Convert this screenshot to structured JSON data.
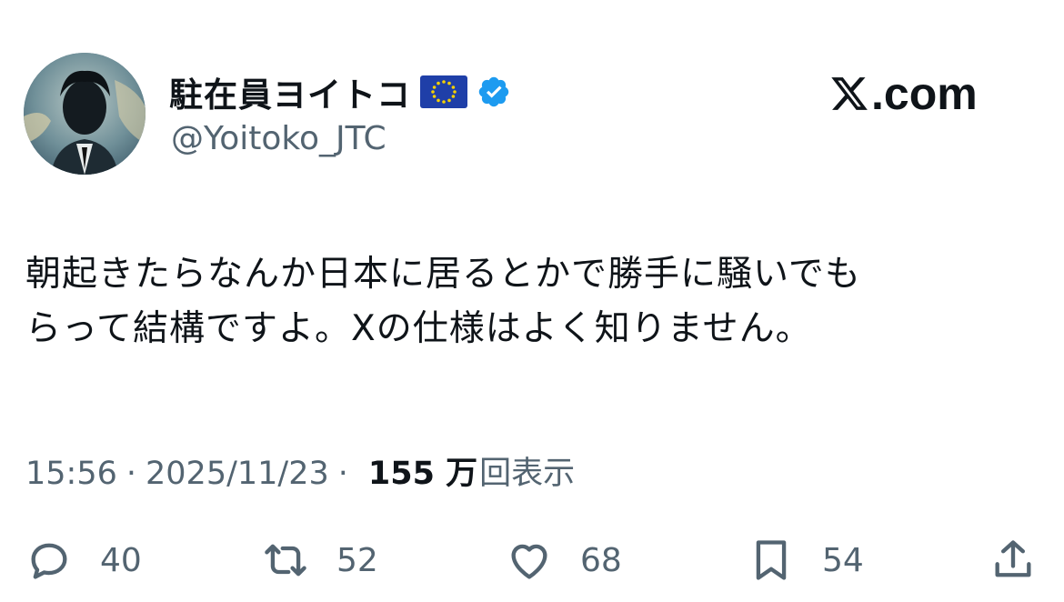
{
  "user": {
    "display_name": "駐在員ヨイトコ",
    "handle": "@Yoitoko_JTC",
    "flag_icon": "eu-flag-icon",
    "verified_icon": "verified-badge-icon",
    "verified_color": "#1d9bf0"
  },
  "brand": {
    "text": ".com",
    "logo_icon": "x-logo-icon"
  },
  "tweet": {
    "text": "朝起きたらなんか日本に居るとかで勝手に騒いでも\nらって結構ですよ。Xの仕様はよく知りません。"
  },
  "meta": {
    "time": "15:56",
    "separator": "·",
    "date": "2025/11/23",
    "views_count": "155 万",
    "views_label": "回表示"
  },
  "actions": {
    "replies": "40",
    "reposts": "52",
    "likes": "68",
    "bookmarks": "54"
  },
  "colors": {
    "text": "#0f1419",
    "secondary": "#536471",
    "accent": "#1d9bf0"
  }
}
